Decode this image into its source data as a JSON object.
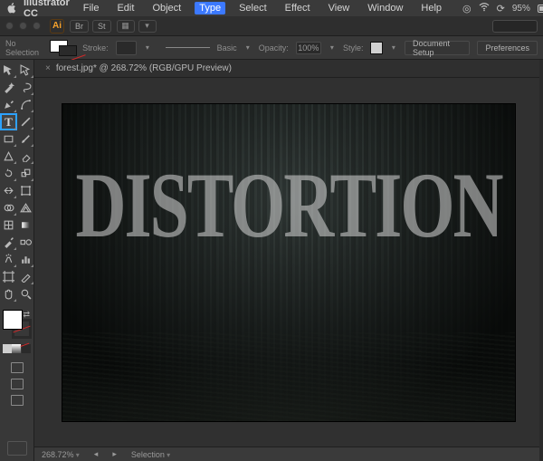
{
  "mac_menu": {
    "app_name": "Illustrator CC",
    "items": [
      "File",
      "Edit",
      "Object",
      "Type",
      "Select",
      "Effect",
      "View",
      "Window",
      "Help"
    ],
    "highlighted_index": 3,
    "battery_pct": "95%"
  },
  "titlebar": {
    "bridge_label": "Br",
    "stock_label": "St"
  },
  "control_bar": {
    "selection_label": "No Selection",
    "stroke_label": "Stroke:",
    "basic_label": "Basic",
    "opacity_label": "Opacity:",
    "opacity_value": "100%",
    "style_label": "Style:",
    "doc_setup_label": "Document Setup",
    "prefs_label": "Preferences"
  },
  "document": {
    "tab_title": "forest.jpg* @ 268.72% (RGB/GPU Preview)",
    "artwork_text": "DISTORTION"
  },
  "statusbar": {
    "zoom": "268.72%",
    "mode_label": "Selection"
  },
  "tools_selected": "type-tool"
}
